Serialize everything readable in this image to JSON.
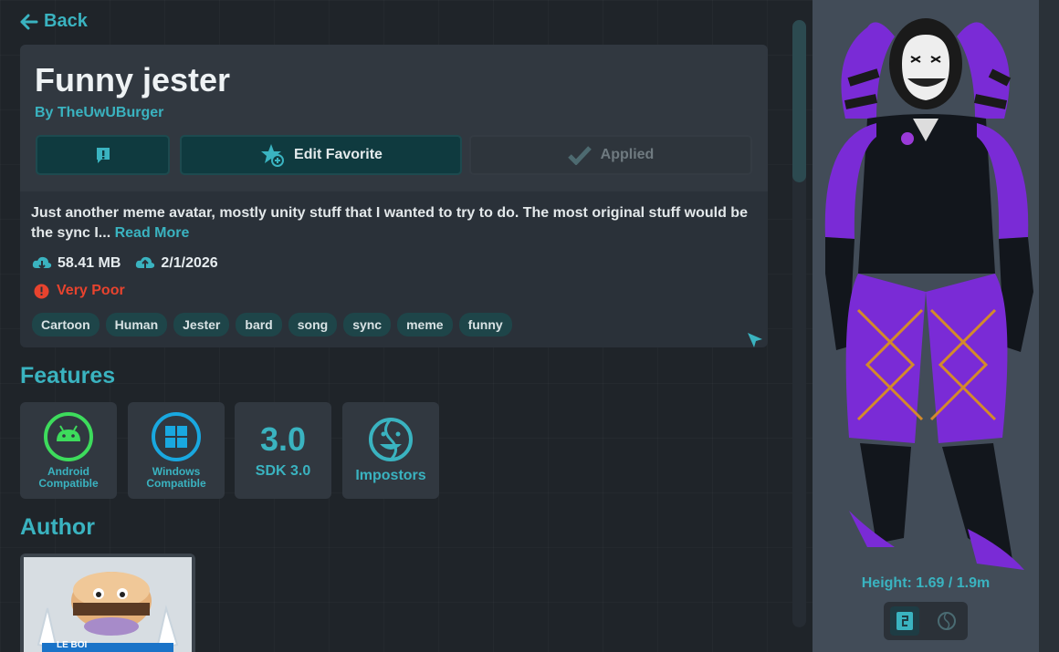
{
  "nav": {
    "back_label": "Back"
  },
  "avatar": {
    "title": "Funny jester",
    "byline": "By TheUwUBurger",
    "buttons": {
      "report_icon": "exclamation-icon",
      "favorite_label": "Edit Favorite",
      "applied_label": "Applied"
    },
    "description": "Just another meme avatar, mostly unity stuff that I wanted to try to do. The most original stuff would be the sync I...",
    "read_more": "Read More",
    "size": "58.41 MB",
    "updated": "2/1/2026",
    "performance": "Very Poor",
    "tags": [
      "Cartoon",
      "Human",
      "Jester",
      "bard",
      "song",
      "sync",
      "meme",
      "funny"
    ]
  },
  "features": {
    "title": "Features",
    "items": {
      "android": "Android Compatible",
      "windows": "Windows Compatible",
      "sdk_version": "3.0",
      "sdk": "SDK 3.0",
      "impostors": "Impostors"
    }
  },
  "author": {
    "title": "Author",
    "banner_text": "LE BOI"
  },
  "preview": {
    "height": "Height: 1.69 / 1.9m"
  },
  "colors": {
    "accent": "#3ab3c0",
    "danger": "#e8432e",
    "android": "#3ddc5c",
    "windows": "#19a8e0"
  }
}
